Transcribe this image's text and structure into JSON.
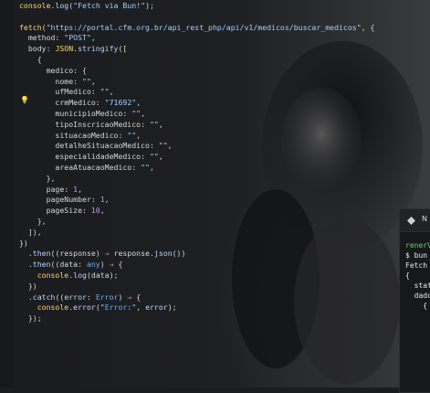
{
  "editor": {
    "lines": [
      {
        "n": "",
        "t": "console.log(\"Fetch via Bun!\");"
      },
      {
        "n": "",
        "t": ""
      },
      {
        "n": "",
        "t": "fetch(\"https://portal.cfm.org.br/api_rest_php/api/v1/medicos/buscar_medicos\", {"
      },
      {
        "n": "",
        "t": "  method: \"POST\","
      },
      {
        "n": "",
        "t": "  body: JSON.stringify(["
      },
      {
        "n": "",
        "t": "    {"
      },
      {
        "n": "",
        "t": "      medico: {"
      },
      {
        "n": "",
        "t": "        nome: \"\","
      },
      {
        "n": "",
        "t": "        ufMedico: \"\","
      },
      {
        "n": "",
        "t": "        crmMedico: \"71692\","
      },
      {
        "n": "",
        "t": "        municipioMedico: \"\","
      },
      {
        "n": "",
        "t": "        tipoInscricaoMedico: \"\","
      },
      {
        "n": "",
        "t": "        situacaoMedico: \"\","
      },
      {
        "n": "",
        "t": "        detalheSituacaoMedico: \"\","
      },
      {
        "n": "",
        "t": "        especialidadeMedico: \"\","
      },
      {
        "n": "",
        "t": "        areaAtuacaoMedico: \"\","
      },
      {
        "n": "",
        "t": "      },"
      },
      {
        "n": "",
        "t": "      page: 1,"
      },
      {
        "n": "",
        "t": "      pageNumber: 1,"
      },
      {
        "n": "",
        "t": "      pageSize: 10,"
      },
      {
        "n": "",
        "t": "    },"
      },
      {
        "n": "",
        "t": "  ]),"
      },
      {
        "n": "",
        "t": "})"
      },
      {
        "n": "",
        "t": "  .then((response) ⇒ response.json())"
      },
      {
        "n": "",
        "t": "  .then((data: any) ⇒ {"
      },
      {
        "n": "",
        "t": "    console.log(data);"
      },
      {
        "n": "",
        "t": "  })"
      },
      {
        "n": "",
        "t": "  .catch((error: Error) ⇒ {"
      },
      {
        "n": "",
        "t": "    console.error(\"Error:\", error);"
      },
      {
        "n": "",
        "t": "  });"
      },
      {
        "n": "",
        "t": ""
      }
    ],
    "active_line_index": 9,
    "lightbulb_icon": "lightbulb-icon"
  },
  "terminal": {
    "title": "N",
    "lines": [
      {
        "t": "renerV",
        "cls": "tgreen"
      },
      {
        "t": "$ bun",
        "cls": ""
      },
      {
        "t": "Fetch",
        "cls": ""
      },
      {
        "t": "{",
        "cls": ""
      },
      {
        "t": "  stat",
        "cls": ""
      },
      {
        "t": "  dado",
        "cls": ""
      },
      {
        "t": "    {",
        "cls": ""
      }
    ],
    "icon": "terminal-app-icon"
  }
}
